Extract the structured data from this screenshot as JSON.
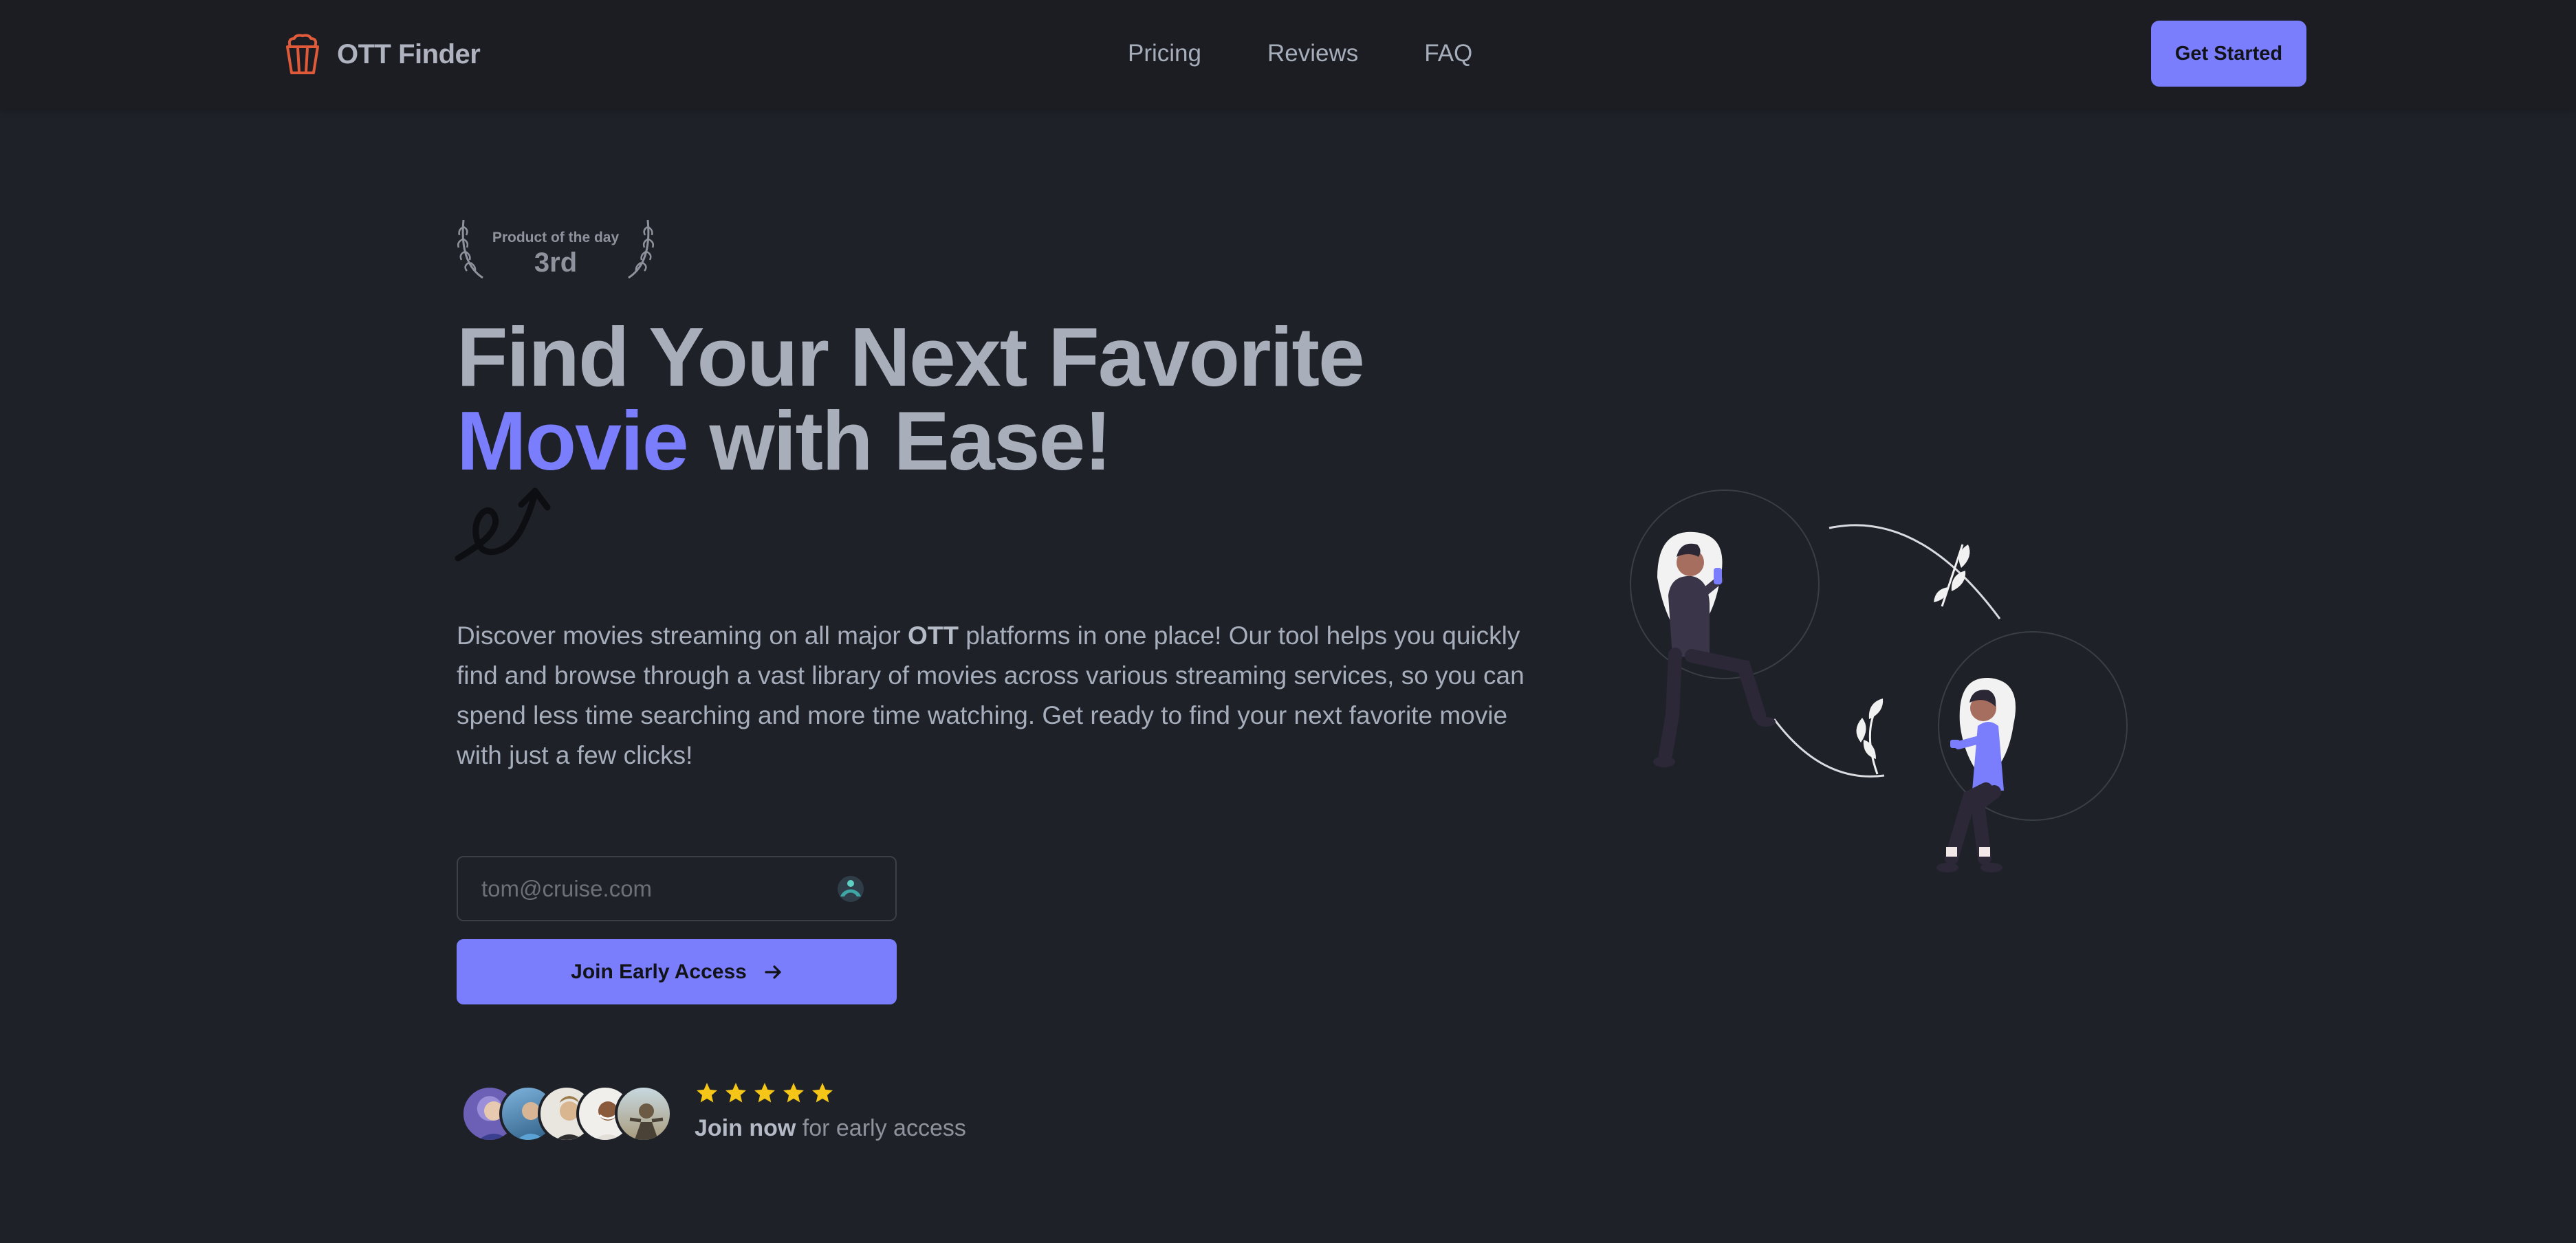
{
  "brand": {
    "name": "OTT Finder",
    "icon": "popcorn-icon",
    "icon_color": "#e05a3a"
  },
  "nav": {
    "links": [
      "Pricing",
      "Reviews",
      "FAQ"
    ],
    "cta_label": "Get Started"
  },
  "badge": {
    "top": "Product of the day",
    "rank": "3rd"
  },
  "headline": {
    "line1": "Find Your Next Favorite",
    "accent": "Movie",
    "rest": " with Ease!"
  },
  "description": {
    "part1": "Discover movies streaming on all major ",
    "bold": "OTT",
    "part2": " platforms in one place! Our tool helps you quickly find and browse through a vast library of movies across various streaming services, so you can spend less time searching and more time watching. Get ready to find your next favorite movie with just a few clicks!"
  },
  "signup": {
    "email_placeholder": "tom@cruise.com",
    "button_label": "Join Early Access",
    "button_icon": "arrow-right-icon",
    "field_icon": "extension-icon"
  },
  "social_proof": {
    "rating": 5,
    "join_bold": "Join now",
    "join_rest": " for early access"
  },
  "colors": {
    "accent": "#7a7efc",
    "background": "#1e2127",
    "navbar": "#1b1d22",
    "star": "#f5c518"
  }
}
